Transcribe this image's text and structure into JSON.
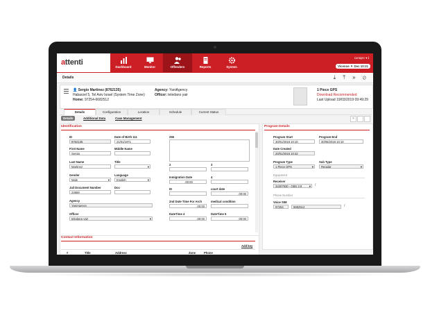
{
  "app": {
    "logo_prefix": "a",
    "logo_rest": "ttenti"
  },
  "nav": [
    {
      "label": "Dashboard",
      "icon": "bar-chart-icon"
    },
    {
      "label": "Monitor",
      "icon": "monitor-icon"
    },
    {
      "label": "Offenders",
      "icon": "people-icon",
      "active": true
    },
    {
      "label": "Reports",
      "icon": "document-icon"
    },
    {
      "label": "System",
      "icon": "gear-icon"
    }
  ],
  "user": {
    "name": "consprc ▾",
    "info_icon": "i",
    "clock_text": "Vicenoe ▼ Dec  10:21"
  },
  "subbar": {
    "title": "Details",
    "tools": "⤓ ⤒ » ⊘"
  },
  "header": {
    "name_line": "Sergio Martinez (8762135)",
    "address": "Habarzel 5, Tel Aviv Israel (System Time Zone)",
    "home_label": "Home:",
    "home_value": "97254-6682512",
    "agency_label": "Agency:",
    "agency_value": "YaniAgency",
    "officer_label": "Officer:",
    "officer_value": "teledano yair",
    "device_name": "1 Piece GPS",
    "device_status": "Download Recommended",
    "last_upload_label": "Last Upload",
    "last_upload_value": "19/03/2019 09:49:29"
  },
  "tabs": [
    "Details",
    "Configuration",
    "Location",
    "Schedule",
    "Current Status"
  ],
  "subtabs": [
    "Details",
    "Additional Data",
    "Case Management"
  ],
  "identification": {
    "title": "Identification",
    "id_label": "ID",
    "id_value": "8762135",
    "dob_label": "Date of Birth 111",
    "dob_value": "21/01/1971",
    "first_label": "First Name",
    "first_value": "Sergio",
    "middle_label": "Middle Name",
    "middle_value": "",
    "last_label": "Last Name",
    "last_value": "Martinez",
    "title_label": "Title",
    "title_value": "",
    "gender_label": "Gender",
    "gender_value": "Male",
    "language_label": "Language",
    "language_value": "English",
    "jail_label": "Jail Document Number",
    "jail_value": "24969",
    "doc_label": "Doc",
    "doc_value": "",
    "agency_label": "Agency",
    "agency_value": "YaniAgency",
    "officer_label": "Officer",
    "officer_value": "teledano yair",
    "f255_label": "255",
    "f2_label": "2",
    "f3_label": "3",
    "immig_label": "Inmigration Date",
    "immig_value": ",00:00",
    "f4_label": "4",
    "id2_label": "ID",
    "court_label": "court date",
    "court_value": ",00:00",
    "arch_label": "2nd Date Time For Arch",
    "arch_value": ",00:00",
    "medical_label": "medical condition",
    "dt4_label": "DateTime 4",
    "dt4_value": ",00:00",
    "dt5_label": "DateTime 5",
    "dt5_value": ",00:00"
  },
  "program": {
    "title": "Program Details",
    "start_label": "Program Start",
    "start_value": "30/01/2018 10:10",
    "end_label": "Program End",
    "end_value": "30/05/2018   10:10",
    "created_label": "Date Created",
    "created_value": "20/01/2018 10:42",
    "type_label": "Program Type",
    "type_value": "1 Piece GPS",
    "subtype_label": "Sub Type",
    "subtype_value": "Regular",
    "equipment_label": "Equipment",
    "receiver_label": "Receiver",
    "receiver_value": "34307930 - GBS 3.9",
    "phone_section": "Phone Number",
    "sim_label": "Voice SIM",
    "sim_prefix": "97254",
    "sim_number": "6682512"
  },
  "contact": {
    "title": "Contact Information",
    "add_label": "Add key",
    "columns": [
      "#",
      "Title",
      "Address",
      "Zone",
      "Phone"
    ]
  }
}
